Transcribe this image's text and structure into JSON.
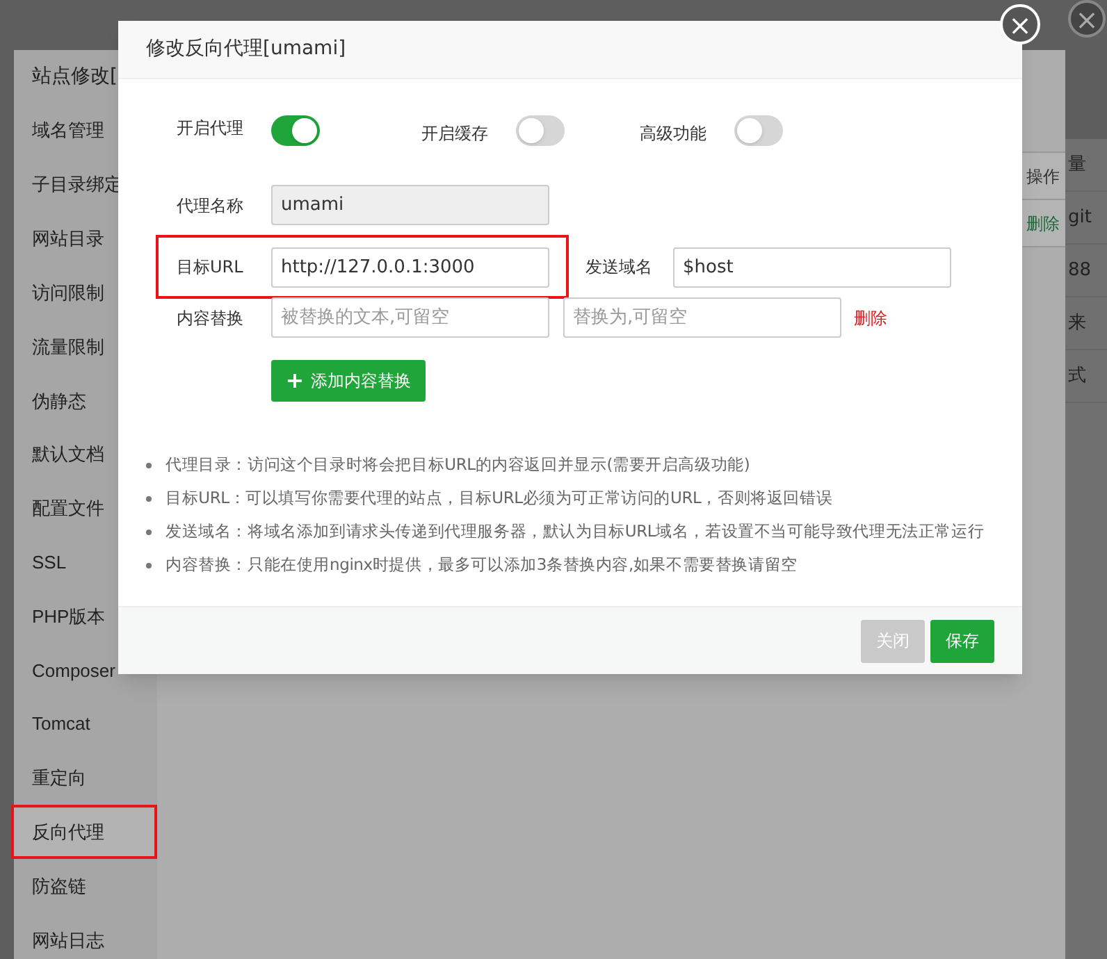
{
  "background_window": {
    "title": "站点修改[",
    "sidebar": {
      "items": [
        {
          "label": "域名管理",
          "selected": false,
          "highlighted": false
        },
        {
          "label": "子目录绑定",
          "selected": false,
          "highlighted": false
        },
        {
          "label": "网站目录",
          "selected": false,
          "highlighted": false
        },
        {
          "label": "访问限制",
          "selected": false,
          "highlighted": false
        },
        {
          "label": "流量限制",
          "selected": false,
          "highlighted": false
        },
        {
          "label": "伪静态",
          "selected": false,
          "highlighted": false
        },
        {
          "label": "默认文档",
          "selected": false,
          "highlighted": false
        },
        {
          "label": "配置文件",
          "selected": false,
          "highlighted": false
        },
        {
          "label": "SSL",
          "selected": false,
          "highlighted": false
        },
        {
          "label": "PHP版本",
          "selected": false,
          "highlighted": false
        },
        {
          "label": "Composer",
          "selected": false,
          "highlighted": false
        },
        {
          "label": "Tomcat",
          "selected": false,
          "highlighted": false
        },
        {
          "label": "重定向",
          "selected": false,
          "highlighted": false
        },
        {
          "label": "反向代理",
          "selected": true,
          "highlighted": true
        },
        {
          "label": "防盗链",
          "selected": false,
          "highlighted": false
        },
        {
          "label": "网站日志",
          "selected": false,
          "highlighted": false
        }
      ]
    },
    "table": {
      "header": "操作",
      "action": "删除"
    },
    "page_fragments": [
      "量",
      "git",
      "88",
      "来",
      "式"
    ],
    "close_button": "×"
  },
  "dialog": {
    "title": "修改反向代理[umami]",
    "close_button": "×",
    "switches": [
      {
        "label": "开启代理",
        "on": true
      },
      {
        "label": "开启缓存",
        "on": false
      },
      {
        "label": "高级功能",
        "on": false
      }
    ],
    "name_field": {
      "label": "代理名称",
      "value": "umami",
      "disabled": true
    },
    "url_row": {
      "label": "目标URL",
      "value": "http://127.0.0.1:3000",
      "highlighted": true,
      "host_label": "发送域名",
      "host_value": "$host"
    },
    "replace_row": {
      "label": "内容替换",
      "from_placeholder": "被替换的文本,可留空",
      "to_placeholder": "替换为,可留空",
      "delete": "删除"
    },
    "add_button": {
      "icon": "+",
      "label": "添加内容替换"
    },
    "notes": [
      "代理目录：访问这个目录时将会把目标URL的内容返回并显示(需要开启高级功能)",
      "目标URL：可以填写你需要代理的站点，目标URL必须为可正常访问的URL，否则将返回错误",
      "发送域名：将域名添加到请求头传递到代理服务器，默认为目标URL域名，若设置不当可能导致代理无法正常运行",
      "内容替换：只能在使用nginx时提供，最多可以添加3条替换内容,如果不需要替换请留空"
    ],
    "buttons": [
      {
        "label": "关闭",
        "kind": "secondary"
      },
      {
        "label": "保存",
        "kind": "primary"
      }
    ]
  }
}
